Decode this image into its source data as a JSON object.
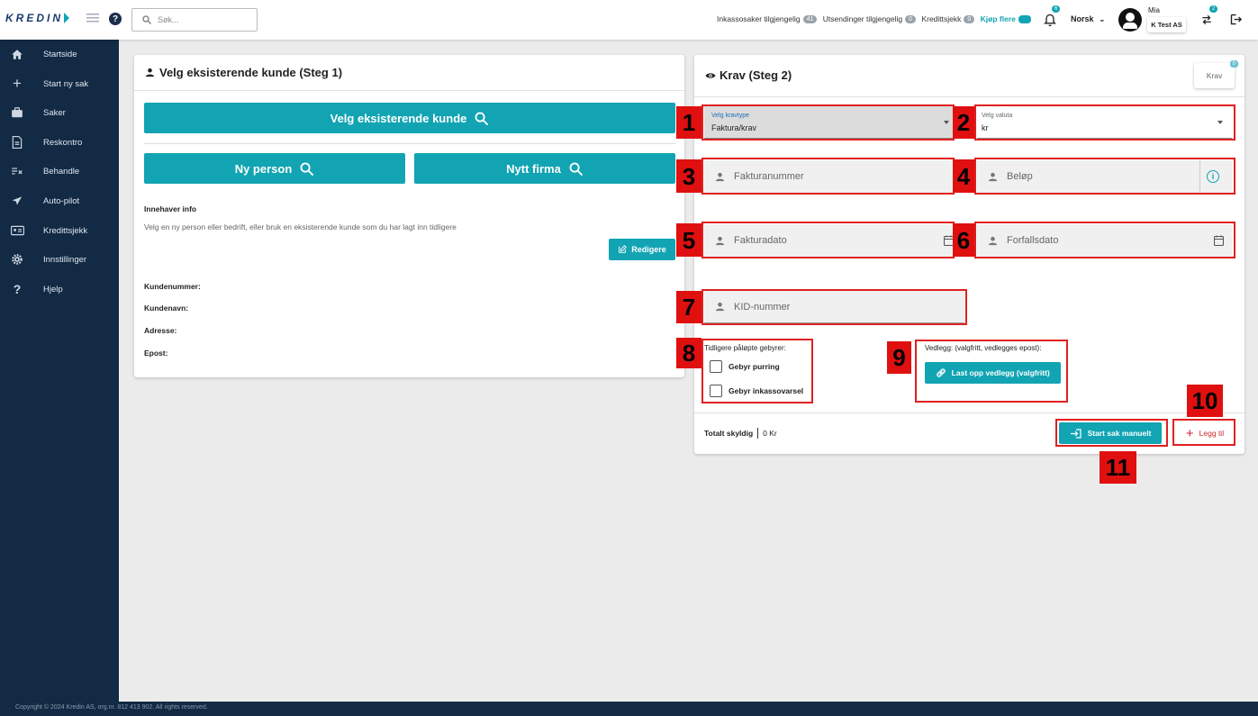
{
  "topbar": {
    "logo_text": "KREDIN",
    "search_placeholder": "Søk...",
    "status": [
      {
        "label": "Inkassosaker tilgjengelig",
        "count": "41"
      },
      {
        "label": "Utsendinger tilgjengelig",
        "count": "0"
      },
      {
        "label": "Kredittsjekk",
        "count": "0"
      }
    ],
    "buy_more": "Kjøp flere",
    "notification_count": "6",
    "language": "Norsk",
    "user_name": "Mia",
    "company": "K Test AS",
    "swap_count": "2"
  },
  "sidebar": {
    "items": [
      {
        "label": "Startside",
        "icon": "home-icon"
      },
      {
        "label": "Start ny sak",
        "icon": "plus-icon"
      },
      {
        "label": "Saker",
        "icon": "briefcase-icon"
      },
      {
        "label": "Reskontro",
        "icon": "document-icon"
      },
      {
        "label": "Behandle",
        "icon": "process-icon"
      },
      {
        "label": "Auto-pilot",
        "icon": "airplane-icon"
      },
      {
        "label": "Kredittsjekk",
        "icon": "id-card-icon"
      },
      {
        "label": "Innstillinger",
        "icon": "gear-icon"
      },
      {
        "label": "Hjelp",
        "icon": "question-icon"
      }
    ]
  },
  "step1": {
    "title": "Velg eksisterende kunde (Steg 1)",
    "select_existing": "Velg eksisterende kunde",
    "new_person": "Ny person",
    "new_company": "Nytt firma",
    "owner_info_title": "Innehaver info",
    "owner_info_text": "Velg en ny person eller bedrift, eller bruk en eksisterende kunde som du har lagt inn tidligere",
    "edit_button": "Redigere",
    "fields": [
      "Kundenummer:",
      "Kundenavn:",
      "Adresse:",
      "Epost:"
    ]
  },
  "step2": {
    "title": "Krav (Steg 2)",
    "krav_button": "Krav",
    "krav_count": "0",
    "claim_type_label": "Velg kravtype",
    "claim_type_value": "Faktura/krav",
    "currency_label": "Velg valuta",
    "currency_value": "kr",
    "invoice_number": "Fakturanummer",
    "amount": "Beløp",
    "invoice_date": "Fakturadato",
    "due_date": "Forfallsdato",
    "kid_number": "KID-nummer",
    "fees_title": "Tidligere påløpte gebyrer:",
    "fee_reminder": "Gebyr purring",
    "fee_notice": "Gebyr inkassovarsel",
    "attachment_title": "Vedlegg: (valgfritt, vedlegges epost):",
    "upload_button": "Last opp vedlegg (valgfritt)",
    "total_label": "Totalt skyldig",
    "total_value": "0 Kr",
    "start_button": "Start sak manuelt",
    "add_button": "Legg til"
  },
  "markers": [
    "1",
    "2",
    "3",
    "4",
    "5",
    "6",
    "7",
    "8",
    "9",
    "10",
    "11"
  ],
  "footer": "Copyright © 2024 Kredin AS, org.nr. 812 413 902. All rights reserved.",
  "colors": {
    "teal": "#12a4b3",
    "navy": "#122a44",
    "marker_red": "#e01010"
  }
}
